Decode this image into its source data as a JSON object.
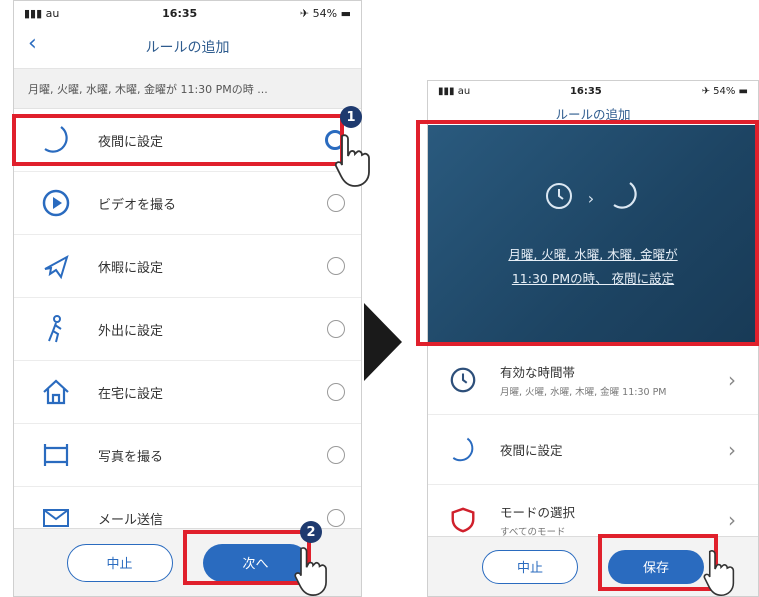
{
  "left_screen": {
    "status": {
      "carrier": "au",
      "time": "16:35",
      "battery": "54%"
    },
    "title": "ルールの追加",
    "summary": "月曜, 火曜, 水曜, 木曜, 金曜が 11:30 PMの時 ...",
    "actions": [
      {
        "label": "夜間に設定",
        "icon": "moon-icon",
        "selected": true
      },
      {
        "label": "ビデオを撮る",
        "icon": "play-icon",
        "selected": false
      },
      {
        "label": "休暇に設定",
        "icon": "airplane-icon",
        "selected": false
      },
      {
        "label": "外出に設定",
        "icon": "walking-person-icon",
        "selected": false
      },
      {
        "label": "在宅に設定",
        "icon": "home-icon",
        "selected": false
      },
      {
        "label": "写真を撮る",
        "icon": "film-icon",
        "selected": false
      },
      {
        "label": "メール送信",
        "icon": "mail-icon",
        "selected": false
      }
    ],
    "cancel_label": "中止",
    "next_label": "次へ"
  },
  "right_screen": {
    "status": {
      "carrier": "au",
      "time": "16:35",
      "battery": "54%"
    },
    "title": "ルールの追加",
    "sentence_line1": "月曜, 火曜, 水曜, 木曜, 金曜が",
    "sentence_line2": "11:30 PMの時、 夜間に設定",
    "rows": [
      {
        "title": "有効な時間帯",
        "subtitle": "月曜, 火曜, 水曜, 木曜, 金曜 11:30 PM",
        "icon": "clock-icon"
      },
      {
        "title": "夜間に設定",
        "subtitle": "",
        "icon": "moon-icon"
      },
      {
        "title": "モードの選択",
        "subtitle": "すべてのモード",
        "icon": "shield-icon"
      }
    ],
    "cancel_label": "中止",
    "save_label": "保存"
  },
  "annotations": {
    "step1": "1",
    "step2": "2"
  },
  "colors": {
    "accent": "#2a6bbf",
    "highlight": "#e0202c",
    "hero": "#1d4463",
    "badge": "#1e3a6f"
  }
}
